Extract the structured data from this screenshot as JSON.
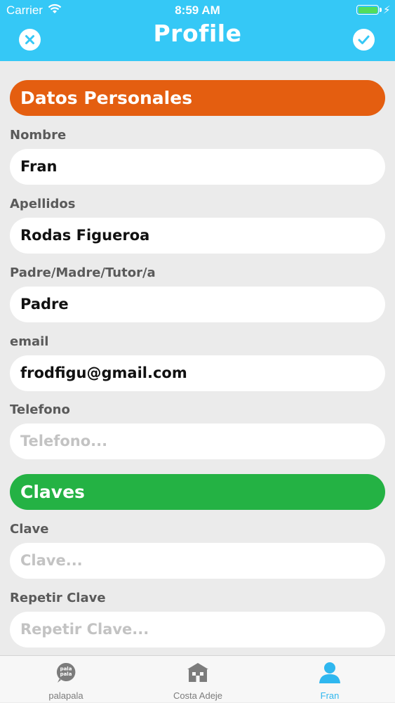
{
  "status_bar": {
    "carrier": "Carrier",
    "time": "8:59 AM"
  },
  "header": {
    "title": "Profile"
  },
  "personal": {
    "section_title": "Datos Personales",
    "fields": [
      {
        "label": "Nombre",
        "value": "Fran"
      },
      {
        "label": "Apellidos",
        "value": "Rodas Figueroa"
      },
      {
        "label": "Padre/Madre/Tutor/a",
        "value": "Padre"
      },
      {
        "label": "email",
        "value": "frodfigu@gmail.com"
      },
      {
        "label": "Telefono",
        "value": "",
        "placeholder": "Telefono..."
      }
    ]
  },
  "keys": {
    "section_title": "Claves",
    "fields": [
      {
        "label": "Clave",
        "value": "",
        "placeholder": "Clave..."
      },
      {
        "label": "Repetir Clave",
        "value": "",
        "placeholder": "Repetir Clave..."
      }
    ]
  },
  "tabbar": {
    "tabs": [
      {
        "label": "palapala",
        "icon": "palapala-logo-icon",
        "active": false,
        "icon_text": "pala pala"
      },
      {
        "label": "Costa Adeje",
        "icon": "school-building-icon",
        "active": false
      },
      {
        "label": "Fran",
        "icon": "user-icon",
        "active": true
      }
    ]
  },
  "colors": {
    "header": "#35c8f6",
    "section_personal": "#e45e10",
    "section_keys": "#24b244",
    "tab_active": "#2fb7ef"
  }
}
